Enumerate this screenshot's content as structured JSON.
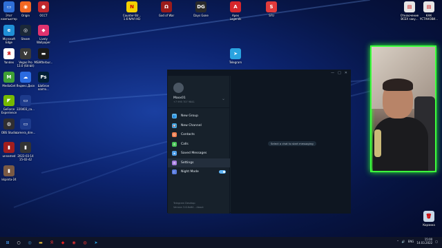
{
  "desktop": {
    "icons": [
      {
        "id": "comp",
        "label": "Этот\nкомпьютер",
        "glyph": "▭",
        "bg": "#2f6fd6"
      },
      {
        "id": "origin",
        "label": "Origin",
        "glyph": "◉",
        "bg": "#f26722"
      },
      {
        "id": "occt",
        "label": "OCCT",
        "glyph": "●",
        "bg": "#c0272d"
      },
      {
        "id": "csgo",
        "label": "Counter-Str...\n1.6 NAVI HD",
        "glyph": "N",
        "bg": "#f4d000"
      },
      {
        "id": "gow",
        "label": "God of War",
        "glyph": "Ω",
        "bg": "#9b1b1b"
      },
      {
        "id": "daysgone",
        "label": "Days Gone",
        "glyph": "DG",
        "bg": "#2a2a2a"
      },
      {
        "id": "apex",
        "label": "Apex\nLegends",
        "glyph": "A",
        "bg": "#d6262b"
      },
      {
        "id": "sfu",
        "label": "SFU",
        "glyph": "S",
        "bg": "#e23b3b"
      },
      {
        "id": "disconnect",
        "label": "Отключение\nВСЕХ заку...",
        "glyph": "▤",
        "bg": "#e6e6e6"
      },
      {
        "id": "install",
        "label": "КАК\nУСТАНОВИ...",
        "glyph": "▤",
        "bg": "#e6e6e6"
      },
      {
        "id": "edge",
        "label": "Microsoft\nEdge",
        "glyph": "e",
        "bg": "#1f8fd6"
      },
      {
        "id": "steam",
        "label": "Steam",
        "glyph": "◎",
        "bg": "#1b2838"
      },
      {
        "id": "lively",
        "label": "Lively\nWallpaper",
        "glyph": "◆",
        "bg": "#e0336f"
      },
      {
        "id": "telegram_desk",
        "label": "Telegram",
        "glyph": "➤",
        "bg": "#2aa3e0"
      },
      {
        "id": "yandex",
        "label": "Yandex",
        "glyph": "Я",
        "bg": "#ffffff"
      },
      {
        "id": "vegas",
        "label": "Vegas Pro\n13.0 (64-bit)",
        "glyph": "V",
        "bg": "#3a3a3a"
      },
      {
        "id": "msiafter",
        "label": "MSIAfterbur...",
        "glyph": "▬",
        "bg": "#1a1a1a"
      },
      {
        "id": "mediaget",
        "label": "MediaGet",
        "glyph": "M",
        "bg": "#3fa035"
      },
      {
        "id": "ydisk",
        "label": "Яндекс.Диск",
        "glyph": "☁",
        "bg": "#2b6be0"
      },
      {
        "id": "ps",
        "label": "Шаблон\nвзяте...",
        "glyph": "Ps",
        "bg": "#001e36"
      },
      {
        "id": "geforce",
        "label": "GeForce\nExperience",
        "glyph": "◤",
        "bg": "#76b900"
      },
      {
        "id": "shot1",
        "label": "220403_ca...",
        "glyph": "▭",
        "bg": "#1d3b8c"
      },
      {
        "id": "obs",
        "label": "OBS Studio",
        "glyph": "◍",
        "bg": "#302e31"
      },
      {
        "id": "camera",
        "label": "camera_dire...",
        "glyph": "▭",
        "bg": "#1d3b8c"
      },
      {
        "id": "unnamed",
        "label": "unnamed",
        "glyph": "▮",
        "bg": "#a11e1e"
      },
      {
        "id": "photo",
        "label": "2022-03-14\n15-02-42",
        "glyph": "▮",
        "bg": "#333"
      },
      {
        "id": "kkpinta",
        "label": "kkpinta-24",
        "glyph": "▮",
        "bg": "#7a5a44"
      },
      {
        "id": "bin",
        "label": "Корзина",
        "glyph": "🗑",
        "bg": "#c8d8e8"
      }
    ]
  },
  "telegram": {
    "window_buttons": [
      "—",
      "□",
      "✕"
    ],
    "profile_name": "Maxx01",
    "profile_phone": "+7 995 707 9841",
    "menu": [
      {
        "id": "new-group",
        "label": "New Group",
        "color": "#5fb3e8",
        "glyph": "👥"
      },
      {
        "id": "new-channel",
        "label": "New Channel",
        "color": "#3fa8e8",
        "glyph": "📢"
      },
      {
        "id": "contacts",
        "label": "Contacts",
        "color": "#ef7a4a",
        "glyph": "☺"
      },
      {
        "id": "calls",
        "label": "Calls",
        "color": "#48c557",
        "glyph": "✆"
      },
      {
        "id": "saved",
        "label": "Saved Messages",
        "color": "#4f9fe8",
        "glyph": "★"
      },
      {
        "id": "settings",
        "label": "Settings",
        "color": "#a77de0",
        "glyph": "⚙"
      },
      {
        "id": "night",
        "label": "Night Mode",
        "color": "#5b7de0",
        "glyph": "☾"
      }
    ],
    "night_mode_on": true,
    "footer_app": "Telegram Desktop",
    "footer_version": "Version 3.6.6x64 – About",
    "empty_hint": "Select a chat to start messaging"
  },
  "taskbar": {
    "apps": [
      {
        "glyph": "⊞",
        "color": "#4aa3ff"
      },
      {
        "glyph": "○",
        "color": "#ffffff"
      },
      {
        "glyph": "◎",
        "color": "#3f9ae0"
      },
      {
        "glyph": "▬",
        "color": "#e0b53a"
      },
      {
        "glyph": "Я",
        "color": "#ff3333"
      },
      {
        "glyph": "◆",
        "color": "#d22"
      },
      {
        "glyph": "◉",
        "color": "#d33"
      },
      {
        "glyph": "◍",
        "color": "#d33"
      },
      {
        "glyph": "➤",
        "color": "#2aa3e0"
      }
    ],
    "lang": "ENG",
    "time": "15:00",
    "date": "14.03.2022"
  }
}
